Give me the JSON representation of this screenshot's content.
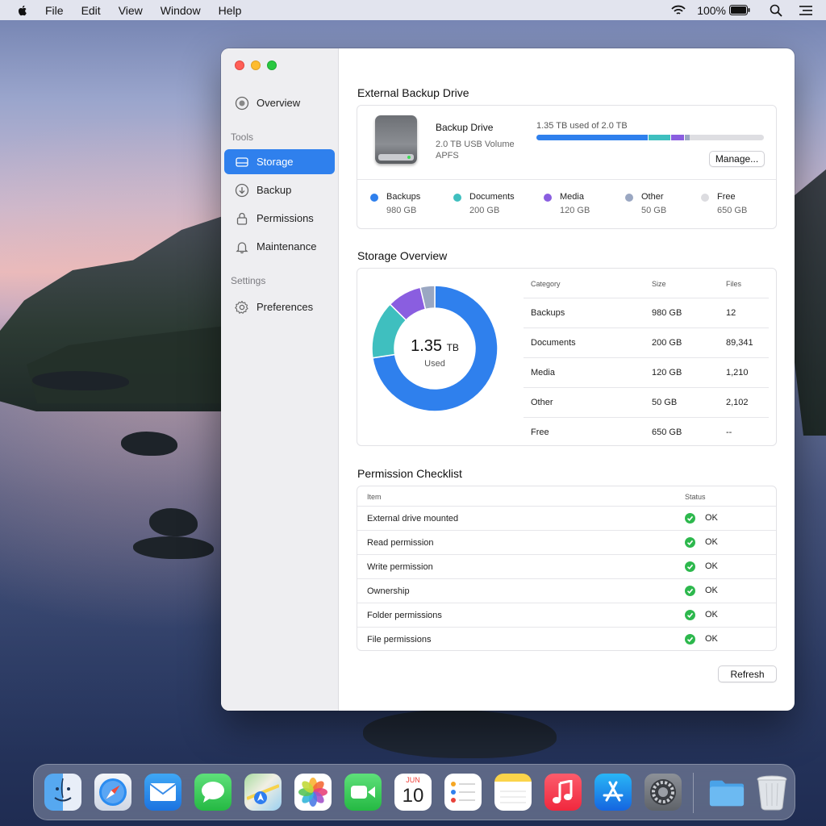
{
  "menubar": {
    "items": [
      "File",
      "Edit",
      "View",
      "Window",
      "Help"
    ],
    "battery": "100%"
  },
  "sidebar": {
    "overview": "Overview",
    "tools_header": "Tools",
    "items": [
      {
        "label": "Storage",
        "icon": "drive-icon",
        "active": true
      },
      {
        "label": "Backup",
        "icon": "backup-icon"
      },
      {
        "label": "Permissions",
        "icon": "lock-icon"
      },
      {
        "label": "Maintenance",
        "icon": "bell-icon"
      }
    ],
    "settings_header": "Settings",
    "preferences": "Preferences"
  },
  "drive": {
    "section_title": "External Backup Drive",
    "name": "Backup Drive",
    "volume": "2.0 TB USB Volume",
    "format": "APFS",
    "usage_text": "1.35 TB used of 2.0 TB",
    "manage_label": "Manage...",
    "legend": [
      {
        "name": "Backups",
        "value": "980 GB",
        "color": "#2f80ed"
      },
      {
        "name": "Documents",
        "value": "200 GB",
        "color": "#3fbfbf"
      },
      {
        "name": "Media",
        "value": "120 GB",
        "color": "#8a5ee0"
      },
      {
        "name": "Other",
        "value": "50 GB",
        "color": "#9aa7c2"
      },
      {
        "name": "Free",
        "value": "650 GB",
        "color": "#dcdce0"
      }
    ]
  },
  "overview": {
    "section_title": "Storage Overview",
    "center_value": "1.35",
    "center_unit": "TB",
    "center_label": "Used",
    "table_headers": [
      "Category",
      "Size",
      "Files"
    ],
    "rows": [
      {
        "category": "Backups",
        "size": "980 GB",
        "files": "12"
      },
      {
        "category": "Documents",
        "size": "200 GB",
        "files": "89,341"
      },
      {
        "category": "Media",
        "size": "120 GB",
        "files": "1,210"
      },
      {
        "category": "Other",
        "size": "50 GB",
        "files": "2,102"
      },
      {
        "category": "Free",
        "size": "650 GB",
        "files": "--"
      }
    ]
  },
  "chart_data": {
    "type": "pie",
    "categories": [
      "Backups",
      "Documents",
      "Media",
      "Other"
    ],
    "values": [
      980,
      200,
      120,
      50
    ],
    "colors": [
      "#2f80ed",
      "#3fbfbf",
      "#8a5ee0",
      "#9aa7c2"
    ],
    "usage_bar": {
      "total_gb": 2000,
      "segments": [
        980,
        200,
        120,
        50,
        650
      ]
    }
  },
  "permissions": {
    "section_title": "Permission Checklist",
    "header_item": "Item",
    "header_status": "Status",
    "rows": [
      {
        "item": "External drive mounted",
        "status": "OK"
      },
      {
        "item": "Read permission",
        "status": "OK"
      },
      {
        "item": "Write permission",
        "status": "OK"
      },
      {
        "item": "Ownership",
        "status": "OK"
      },
      {
        "item": "Folder permissions",
        "status": "OK"
      },
      {
        "item": "File permissions",
        "status": "OK"
      }
    ],
    "refresh_label": "Refresh"
  },
  "dock": {
    "apps": [
      "finder",
      "safari",
      "mail",
      "messages",
      "maps",
      "photos",
      "facetime",
      "calendar",
      "reminders",
      "notes",
      "music",
      "app-store",
      "system-preferences",
      "downloads-folder",
      "trash"
    ],
    "calendar_month": "JUN",
    "calendar_day": "10"
  }
}
